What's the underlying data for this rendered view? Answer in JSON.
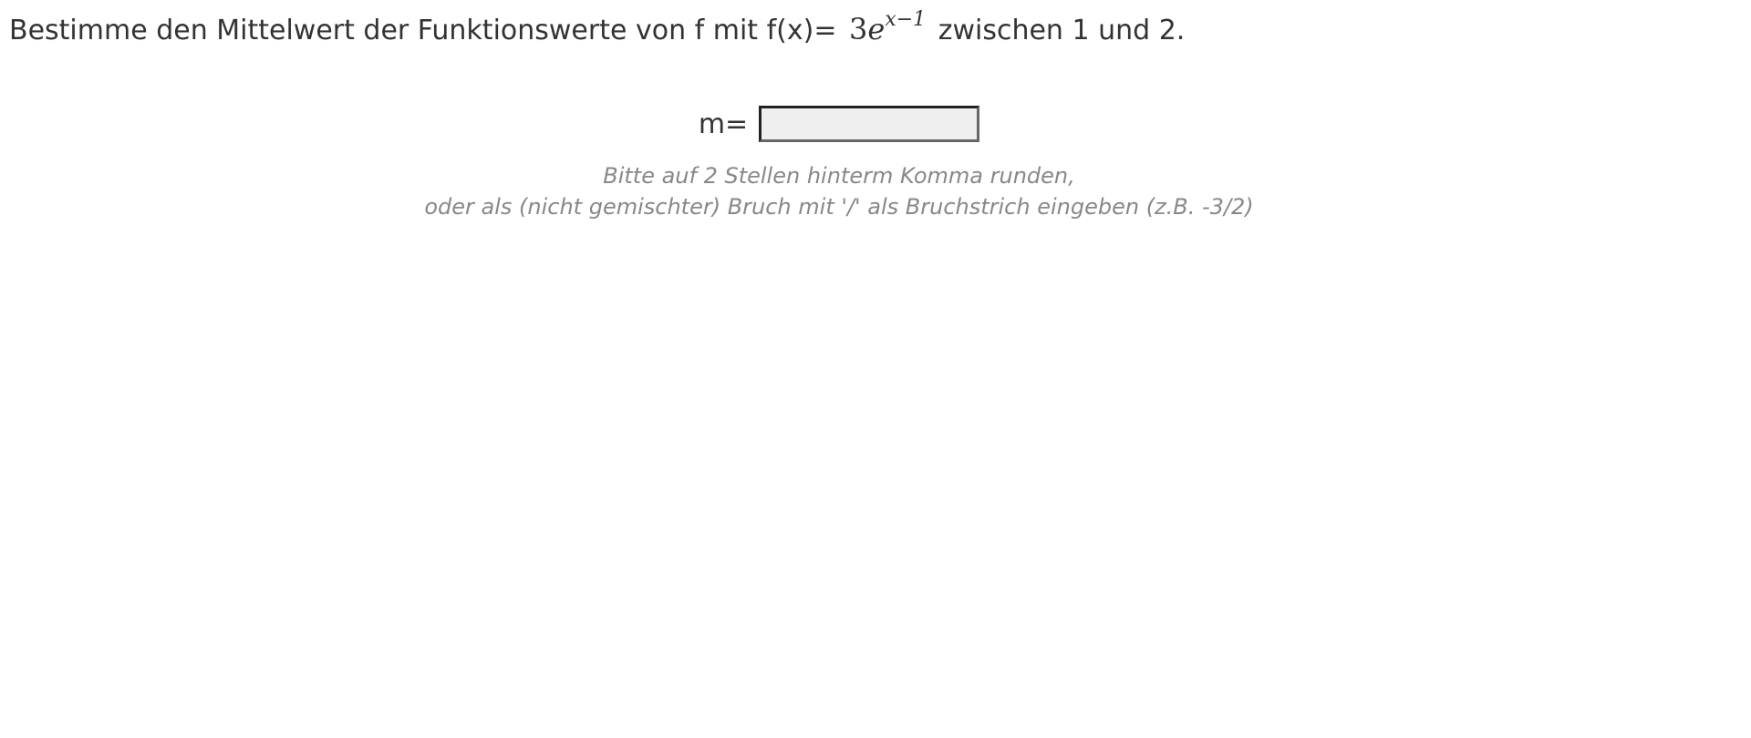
{
  "task": {
    "prefix": "Bestimme den Mittelwert der Funktionswerte von f mit f(x)=",
    "formula": {
      "coefficient": "3",
      "base": "e",
      "exponent": "x−1"
    },
    "suffix": "zwischen 1 und 2."
  },
  "answer": {
    "label": "m=",
    "value": "",
    "placeholder": ""
  },
  "hint": {
    "line1": "Bitte auf 2 Stellen hinterm Komma runden,",
    "line2": "oder als (nicht gemischter) Bruch mit '/' als Bruchstrich eingeben (z.B. -3/2)"
  },
  "colors": {
    "text": "#333333",
    "hint": "#888888",
    "input_bg": "#efefef",
    "input_border": "#666666"
  }
}
